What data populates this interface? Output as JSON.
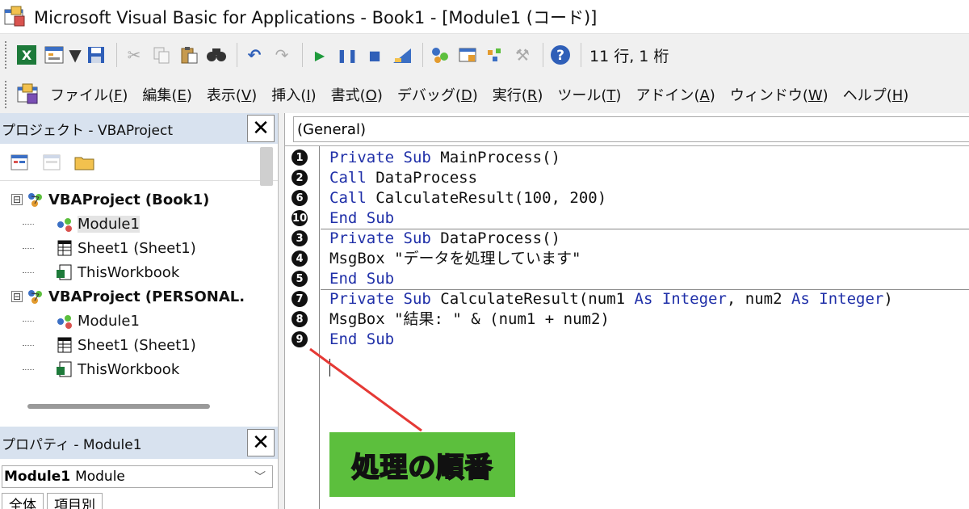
{
  "window": {
    "title": "Microsoft Visual Basic for Applications - Book1 - [Module1 (コード)]"
  },
  "toolbar": {
    "icons": [
      "excel-icon",
      "insert-form-icon",
      "dropdown-arrow-icon",
      "save-icon",
      "cut-icon",
      "copy-icon",
      "paste-icon",
      "find-icon",
      "undo-icon",
      "redo-icon",
      "run-icon",
      "break-icon",
      "reset-icon",
      "design-mode-icon",
      "project-explorer-icon",
      "properties-icon",
      "object-browser-icon",
      "toolbox-icon",
      "help-icon"
    ],
    "position": "11 行, 1 桁"
  },
  "menubar": {
    "items": [
      {
        "label": "ファイル",
        "key": "F"
      },
      {
        "label": "編集",
        "key": "E"
      },
      {
        "label": "表示",
        "key": "V"
      },
      {
        "label": "挿入",
        "key": "I"
      },
      {
        "label": "書式",
        "key": "O"
      },
      {
        "label": "デバッグ",
        "key": "D"
      },
      {
        "label": "実行",
        "key": "R"
      },
      {
        "label": "ツール",
        "key": "T"
      },
      {
        "label": "アドイン",
        "key": "A"
      },
      {
        "label": "ウィンドウ",
        "key": "W"
      },
      {
        "label": "ヘルプ",
        "key": "H"
      }
    ]
  },
  "project": {
    "title": "プロジェクト - VBAProject",
    "close": "✕",
    "tree": [
      {
        "label": "VBAProject (Book1)",
        "level": 0,
        "bold": true,
        "icon": "vba-project-icon",
        "expander": "⊟"
      },
      {
        "label": "Module1",
        "level": 1,
        "bold": false,
        "icon": "module-icon",
        "selected": true
      },
      {
        "label": "Sheet1 (Sheet1)",
        "level": 1,
        "bold": false,
        "icon": "sheet-icon"
      },
      {
        "label": "ThisWorkbook",
        "level": 1,
        "bold": false,
        "icon": "workbook-icon"
      },
      {
        "label": "VBAProject (PERSONAL.",
        "level": 0,
        "bold": true,
        "icon": "vba-project-icon",
        "expander": "⊟"
      },
      {
        "label": "Module1",
        "level": 1,
        "bold": false,
        "icon": "module-icon"
      },
      {
        "label": "Sheet1 (Sheet1)",
        "level": 1,
        "bold": false,
        "icon": "sheet-icon"
      },
      {
        "label": "ThisWorkbook",
        "level": 1,
        "bold": false,
        "icon": "workbook-icon"
      }
    ]
  },
  "properties": {
    "title": "プロパティ - Module1",
    "close": "✕",
    "object_name": "Module1",
    "object_type": "Module",
    "tabs": [
      "全体",
      "項目別"
    ]
  },
  "code": {
    "combo": "(General)",
    "lines": [
      {
        "n": "1",
        "parts": [
          {
            "t": "Private Sub",
            "kw": true
          },
          {
            "t": " MainProcess()",
            "kw": false
          }
        ]
      },
      {
        "n": "2",
        "parts": [
          {
            "t": "Call",
            "kw": true
          },
          {
            "t": " DataProcess",
            "kw": false
          }
        ]
      },
      {
        "n": "6",
        "parts": [
          {
            "t": "Call",
            "kw": true
          },
          {
            "t": " CalculateResult(100, 200)",
            "kw": false
          }
        ]
      },
      {
        "n": "10",
        "parts": [
          {
            "t": "End Sub",
            "kw": true
          }
        ]
      },
      {
        "n": "3",
        "parts": [
          {
            "t": "Private Sub",
            "kw": true
          },
          {
            "t": " DataProcess()",
            "kw": false
          }
        ]
      },
      {
        "n": "4",
        "parts": [
          {
            "t": "MsgBox \"データを処理しています\"",
            "kw": false
          }
        ]
      },
      {
        "n": "5",
        "parts": [
          {
            "t": "End Sub",
            "kw": true
          }
        ]
      },
      {
        "n": "7",
        "parts": [
          {
            "t": "Private Sub",
            "kw": true
          },
          {
            "t": " CalculateResult(num1 ",
            "kw": false
          },
          {
            "t": "As Integer",
            "kw": true
          },
          {
            "t": ", num2 ",
            "kw": false
          },
          {
            "t": "As Integer",
            "kw": true
          },
          {
            "t": ")",
            "kw": false
          }
        ]
      },
      {
        "n": "8",
        "parts": [
          {
            "t": "MsgBox \"結果: \" & (num1 + num2)",
            "kw": false
          }
        ]
      },
      {
        "n": "9",
        "parts": [
          {
            "t": "End Sub",
            "kw": true
          }
        ]
      }
    ]
  },
  "annotation": {
    "label": "処理の順番",
    "bg": "#5cbf3d",
    "arrow_color": "#e53935"
  }
}
